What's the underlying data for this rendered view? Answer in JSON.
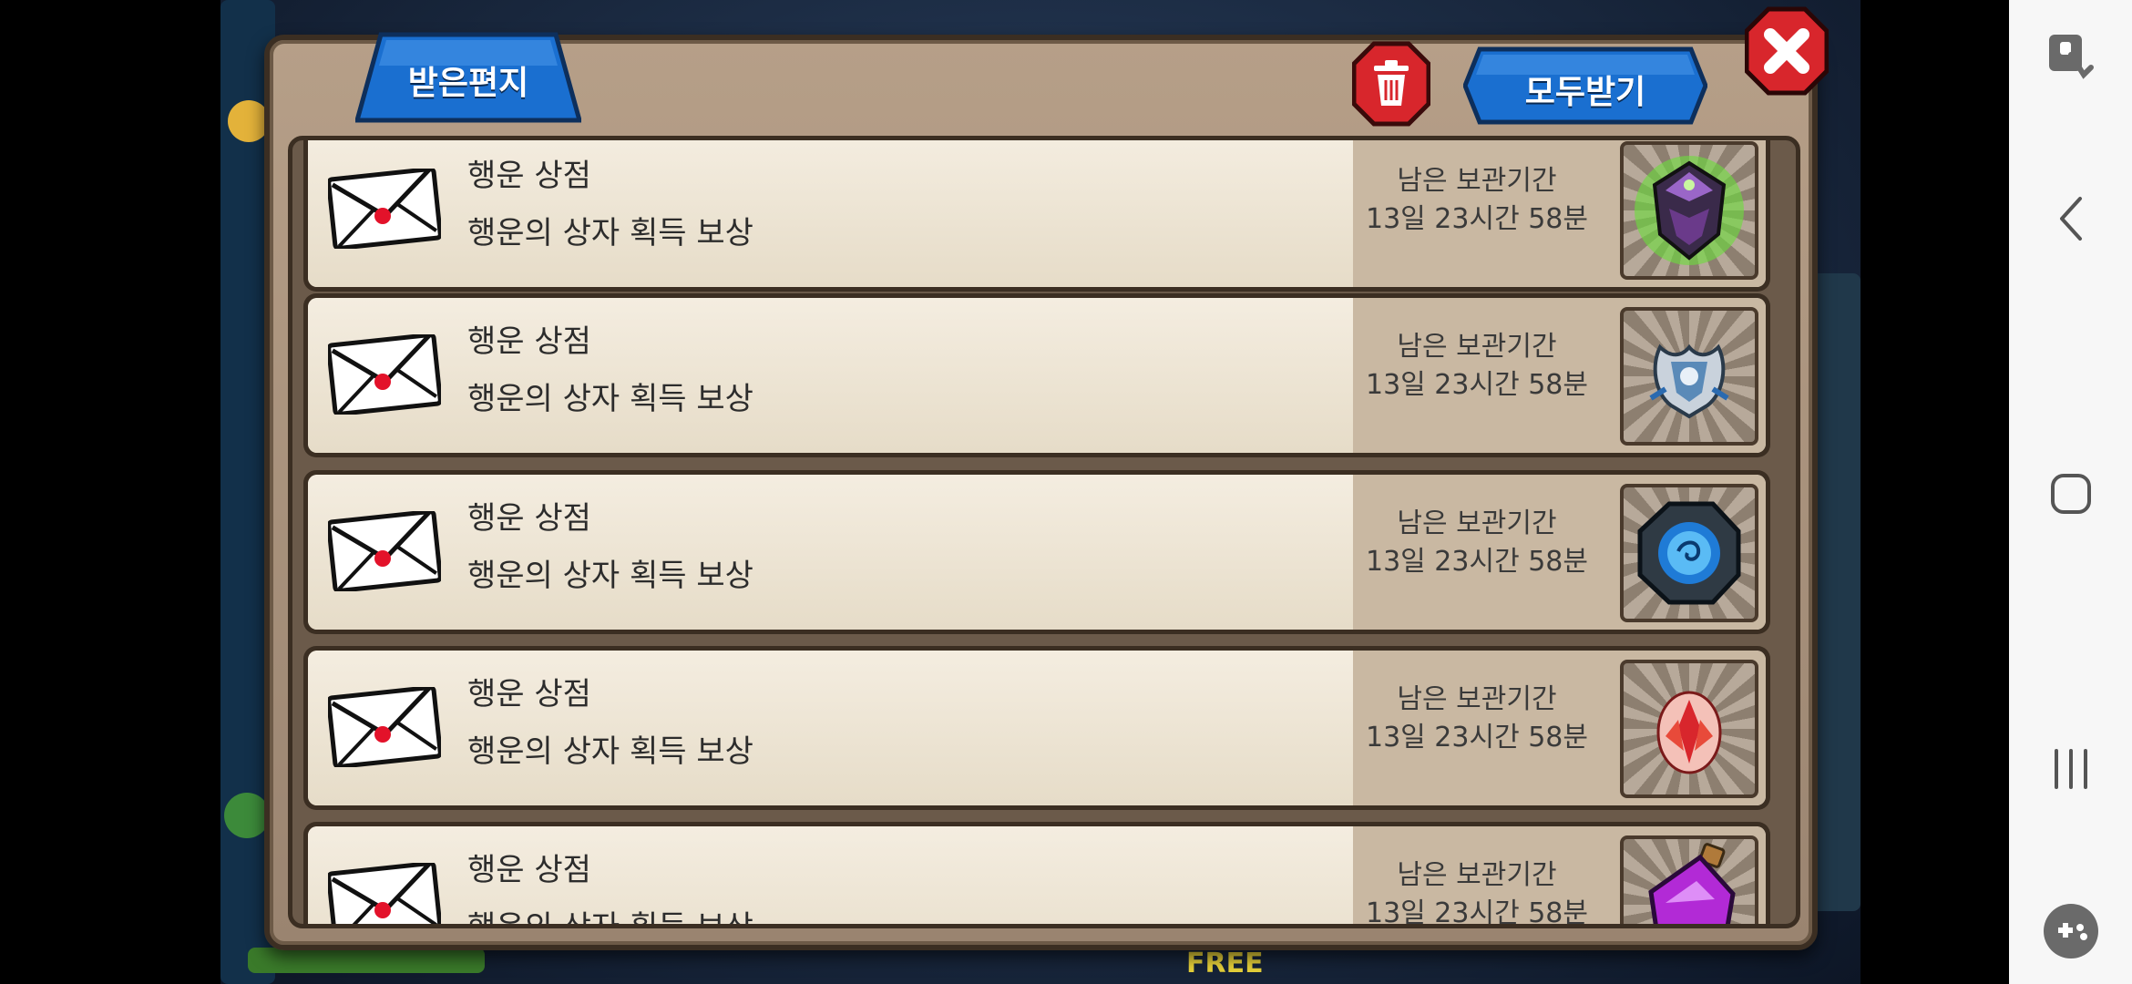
{
  "mailbox": {
    "tab_label": "받은편지",
    "receive_all_label": "모두받기",
    "items": [
      {
        "title": "행운 상점",
        "desc": "행운의 상자 획득 보상",
        "keep_label": "남은 보관기간",
        "keep_time": "13일 23시간 58분",
        "reward_icon": "dark-helmet-icon"
      },
      {
        "title": "행운 상점",
        "desc": "행운의 상자 획득 보상",
        "keep_label": "남은 보관기간",
        "keep_time": "13일 23시간 58분",
        "reward_icon": "silver-crest-icon"
      },
      {
        "title": "행운 상점",
        "desc": "행운의 상자 획득 보상",
        "keep_label": "남은 보관기간",
        "keep_time": "13일 23시간 58분",
        "reward_icon": "blue-orb-stone-icon"
      },
      {
        "title": "행운 상점",
        "desc": "행운의 상자 획득 보상",
        "keep_label": "남은 보관기간",
        "keep_time": "13일 23시간 58분",
        "reward_icon": "red-egg-icon"
      },
      {
        "title": "행운 상점",
        "desc": "행운의 상자 획득 보상",
        "keep_label": "남은 보관기간",
        "keep_time": "13일 23시간 58분",
        "reward_icon": "purple-potion-icon"
      }
    ]
  },
  "background": {
    "free_label": "FREE"
  },
  "colors": {
    "tab_blue": "#1a6fd0",
    "close_red": "#d8262c",
    "card_bg": "#f0e8d8",
    "frame_brown": "#3b2e22"
  }
}
